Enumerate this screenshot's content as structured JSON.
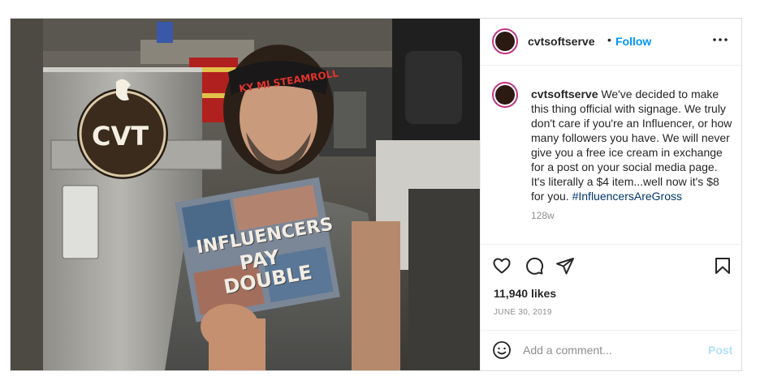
{
  "post": {
    "username": "cvtsoftserve",
    "follow_label": "Follow",
    "separator": "•",
    "caption": {
      "username": "cvtsoftserve",
      "text": "We've decided to make this thing official with signage. We truly don't care if you're an Influencer, or how many followers you have. We will never give you a free ice cream in exchange for a post on your social media page. It's literally a $4 item...well now it's $8 for you.",
      "hashtag": "#InfluencersAreGross"
    },
    "age": "128w",
    "likes": "11,940 likes",
    "date": "JUNE 30, 2019",
    "comment": {
      "placeholder": "Add a comment...",
      "value": "",
      "post_label": "Post"
    }
  },
  "photo": {
    "headband_text": "KY MI STEAMROLL",
    "sign_lines": [
      "INFLUENCERS",
      "PAY",
      "DOUBLE"
    ],
    "store_logo": "CVT"
  },
  "icons": {
    "more": "more-options-icon",
    "like": "heart-icon",
    "comment": "comment-icon",
    "share": "share-icon",
    "save": "bookmark-icon",
    "emoji": "emoji-icon"
  },
  "colors": {
    "follow": "#0095f6",
    "hashtag": "#00376b",
    "post_disabled": "#b2dffc",
    "story_ring": "#c13584"
  }
}
